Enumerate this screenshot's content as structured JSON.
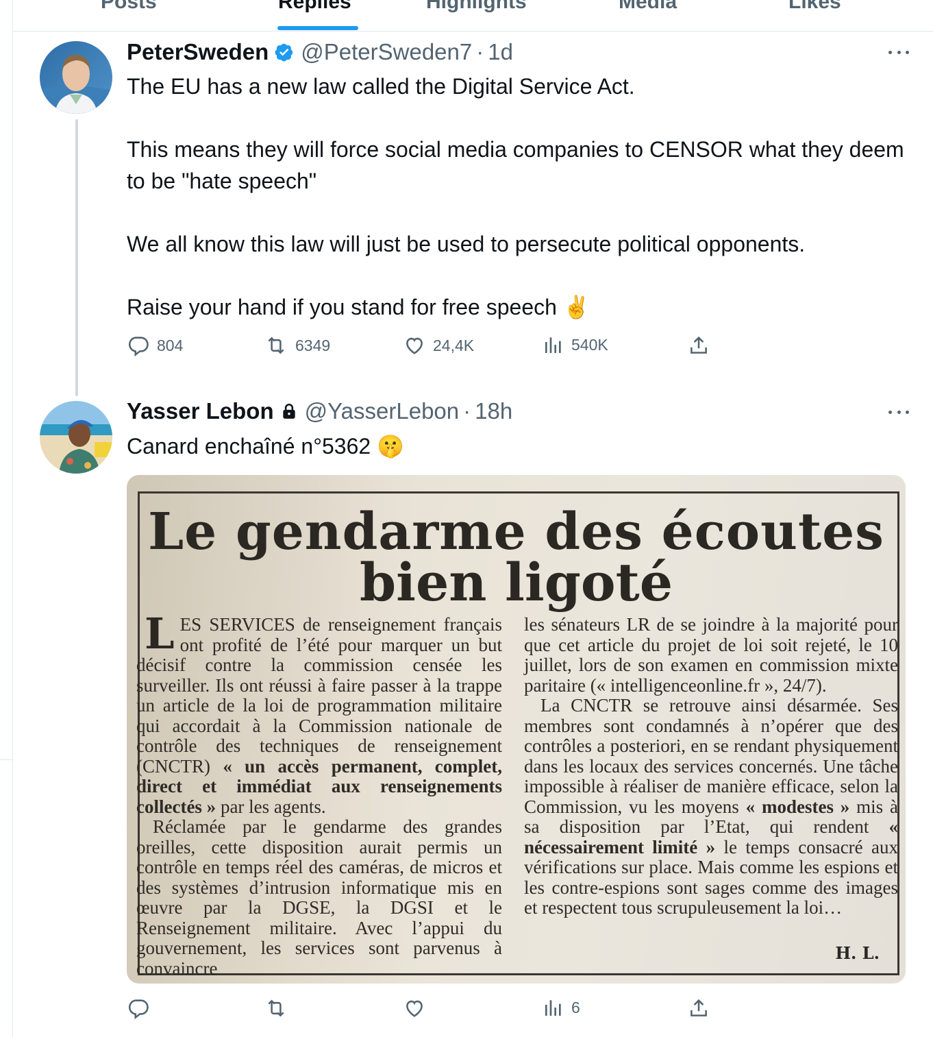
{
  "tabs": [
    {
      "label": "Posts",
      "active": false
    },
    {
      "label": "Replies",
      "active": true
    },
    {
      "label": "Highlights",
      "active": false
    },
    {
      "label": "Media",
      "active": false
    },
    {
      "label": "Likes",
      "active": false
    }
  ],
  "colors": {
    "accent": "#1d9bf0",
    "muted": "#536471",
    "text": "#0f1419",
    "divider": "#e1e8ed"
  },
  "tweet1": {
    "name": "PeterSweden",
    "verified_icon": "verified-badge-icon",
    "handle": "@PeterSweden7",
    "dot": "·",
    "time": "1d",
    "lines": [
      "The EU has a new law called the Digital Service Act.",
      "This means they will force social media companies to CENSOR what they deem to be \"hate speech\"",
      "We all know this law will just be used to persecute political opponents.",
      "Raise your hand if you stand for free speech ✌️"
    ],
    "replies": "804",
    "reposts": "6349",
    "likes": "24,4K",
    "views": "540K"
  },
  "tweet2": {
    "name": "Yasser Lebon",
    "protected_icon": "lock-icon",
    "handle": "@YasserLebon",
    "dot": "·",
    "time": "18h",
    "text": "Canard enchaîné n°5362 🤫",
    "replies": "",
    "reposts": "",
    "likes": "",
    "views": "6",
    "media": {
      "headline_1": "Le gendarme des écoutes",
      "headline_2": "bien ligoté",
      "dropcap": "L",
      "left_col": [
        "ES SERVICES de renseignement français ont profité de l’été pour marquer un but décisif contre la commission censée les surveiller. Ils ont réussi à faire passer à la trappe un article de la loi de programmation militaire qui accordait à la Commission nationale de contrôle des techniques de renseignement (CNCTR) ",
        "« un accès permanent, complet, direct et immédiat aux renseignements collectés »",
        " par les agents.",
        "Réclamée par le gendarme des grandes oreilles, cette disposition aurait permis un contrôle en temps réel des caméras, de micros et des systèmes d’intrusion informatique mis en œuvre par la DGSE, la DGSI et le Renseignement militaire. Avec l’appui du gouvernement, les services sont parvenus à convaincre"
      ],
      "right_col": [
        "les sénateurs LR de se joindre à la majorité pour que cet article du projet de loi soit rejeté, le 10 juillet, lors de son examen en commission mixte paritaire (« intelligenceonline.fr », 24/7).",
        "La CNCTR se retrouve ainsi désarmée. Ses membres sont condamnés à n’opérer que des contrôles a posteriori, en se rendant physiquement dans les locaux des services concernés. Une tâche impossible à réaliser de manière efficace, selon la Commission, vu les moyens ",
        "« modestes »",
        " mis à sa disposition par l’Etat, qui rendent ",
        "« nécessairement limité »",
        " le temps consacré aux vérifications sur place. Mais comme les espions et les contre-espions sont sages comme des images et respectent tous scrupuleusement la loi…"
      ],
      "signature": "H. L."
    }
  }
}
